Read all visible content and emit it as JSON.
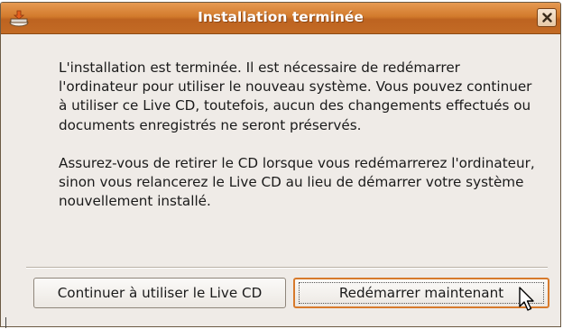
{
  "window": {
    "title": "Installation terminée",
    "title_icon": "installer-icon",
    "close_icon": "close-icon"
  },
  "message": {
    "paragraph1": "L'installation est terminée. Il est nécessaire de redémarrer l'ordinateur pour utiliser le nouveau système. Vous pouvez continuer à utiliser ce Live CD, toutefois, aucun des changements effectués ou documents enregistrés ne seront préservés.",
    "paragraph2": "Assurez-vous de retirer le CD lorsque vous redémarrerez l'ordinateur, sinon vous relancerez le Live CD au lieu de démarrer votre système nouvellement installé."
  },
  "buttons": {
    "continue_label": "Continuer à utiliser le Live CD",
    "restart_label": "Redémarrer maintenant",
    "default": "restart"
  },
  "colors": {
    "titlebar": "#d27a2c",
    "focus_border": "#d77a2c",
    "dialog_bg": "#efebe7"
  },
  "cursor": "mouse-pointer-icon"
}
